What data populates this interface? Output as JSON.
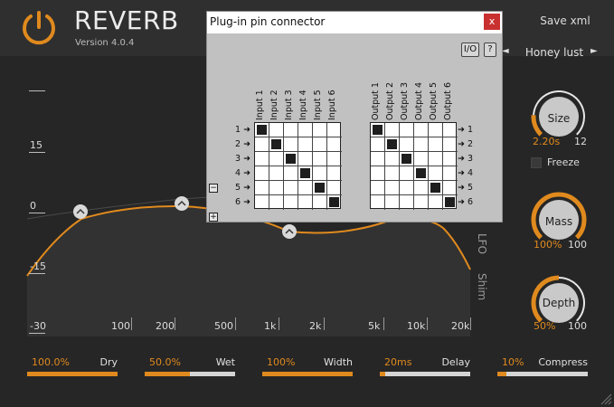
{
  "app": {
    "title": "REVERB",
    "version": "Version 4.0.4",
    "save_label": "Save xml",
    "preset": {
      "prev": "◄",
      "name": "Honey lust",
      "next": "►"
    }
  },
  "graph": {
    "db_labels": [
      "15",
      "0",
      "-15",
      "-30"
    ],
    "freq_labels": [
      "100",
      "200",
      "500",
      "1k",
      "2k",
      "5k",
      "10k",
      "20k"
    ],
    "side_labels": [
      "LFO",
      "Shim"
    ]
  },
  "knobs": [
    {
      "label": "Size",
      "value": "2.20s",
      "max": "12",
      "fraction": 0.18
    },
    {
      "label": "Mass",
      "value": "100%",
      "max": "100",
      "fraction": 1.0
    },
    {
      "label": "Depth",
      "value": "50%",
      "max": "100",
      "fraction": 0.5
    }
  ],
  "freeze_label": "Freeze",
  "sliders": [
    {
      "value": "100.0%",
      "name": "Dry",
      "fraction": 1.0
    },
    {
      "value": "50.0%",
      "name": "Wet",
      "fraction": 0.5
    },
    {
      "value": "100%",
      "name": "Width",
      "fraction": 1.0
    },
    {
      "value": "20ms",
      "name": "Delay",
      "fraction": 0.03
    },
    {
      "value": "10%",
      "name": "Compress",
      "fraction": 0.1
    }
  ],
  "dialog": {
    "title": "Plug-in pin connector",
    "close": "x",
    "io_button": "I/O",
    "help_button": "?",
    "inputs": [
      "Input 1",
      "Input 2",
      "Input 3",
      "Input 4",
      "Input 5",
      "Input 6"
    ],
    "outputs": [
      "Output 1",
      "Output 2",
      "Output 3",
      "Output 4",
      "Output 5",
      "Output 6"
    ],
    "row_labels": [
      "1 ➜",
      "2 ➜",
      "3 ➜",
      "4 ➜",
      "5 ➜",
      "6 ➜"
    ],
    "out_row_labels": [
      "➜ 1",
      "➜ 2",
      "➜ 3",
      "➜ 4",
      "➜ 5",
      "➜ 6"
    ],
    "minus": "−",
    "plus": "+"
  },
  "colors": {
    "accent": "#e08a1e",
    "background": "#262626"
  }
}
